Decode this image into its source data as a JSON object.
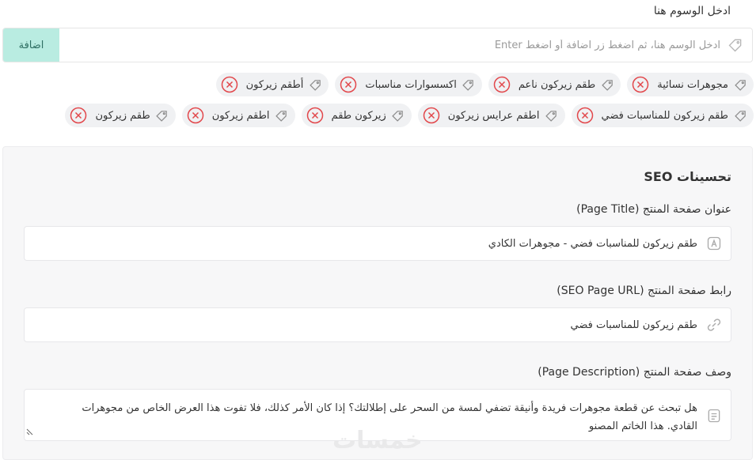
{
  "tags": {
    "label": "ادخل الوسوم هنا",
    "placeholder": "ادخل الوسم هنا، ثم اضغط زر اضافة أو اضغط Enter",
    "add_label": "اضافة",
    "icon": "tag-icon",
    "row1": [
      "مجوهرات نسائية",
      "طقم زيركون ناعم",
      "اكسسوارات مناسبات",
      "أطقم زيركون"
    ],
    "row2": [
      "طقم زيركون للمناسبات فضي",
      "اطقم عرايس زيركون",
      "زيركون طقم",
      "اطقم زيركون",
      "طقم زيركون"
    ]
  },
  "seo": {
    "title": "تحسينات SEO",
    "page_title_label": "عنوان صفحة المنتج (Page Title)",
    "page_title_value": "طقم زيركون للمناسبات فضي - مجوهرات الكادي",
    "url_label": "رابط صفحة المنتج (SEO Page URL)",
    "url_value": "طقم زيركون للمناسبات فضي",
    "desc_label": "وصف صفحة المنتج (Page Description)",
    "desc_value": "هل تبحث عن قطعة مجوهرات فريدة وأنيقة تضفي لمسة من السحر على إطلالتك؟ إذا كان الأمر كذلك، فلا تفوت هذا العرض الخاص من مجوهرات القادي. هذا الخاتم المصنو"
  },
  "watermark": "خمسات",
  "colors": {
    "add_button_bg": "#b9ece1",
    "remove_red": "#e2474b",
    "card_bg": "#f7f7f8"
  }
}
